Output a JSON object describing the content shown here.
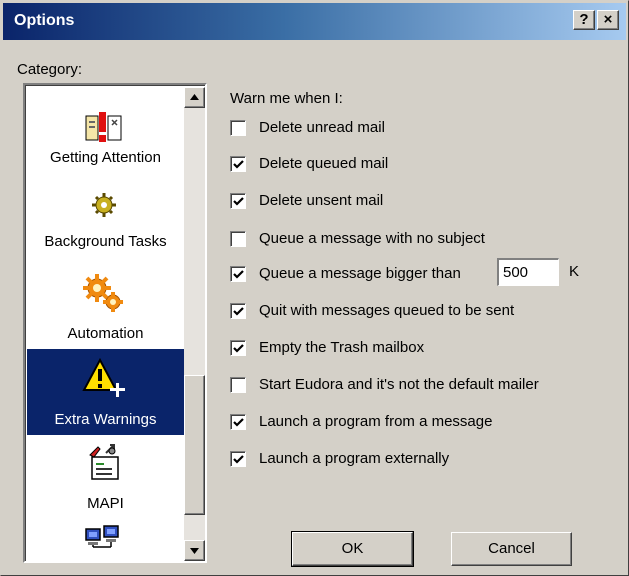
{
  "window": {
    "title": "Options",
    "help_button": "?",
    "close_button": "×"
  },
  "category": {
    "label": "Category:",
    "items": [
      {
        "label": "Getting Attention",
        "icon": "getting-attention-icon"
      },
      {
        "label": "Background Tasks",
        "icon": "background-tasks-gear-icon"
      },
      {
        "label": "Automation",
        "icon": "automation-gears-icon"
      },
      {
        "label": "Extra Warnings",
        "icon": "warning-triangle-icon",
        "selected": true
      },
      {
        "label": "MAPI",
        "icon": "mapi-icon"
      },
      {
        "label": "",
        "icon": "network-computers-icon"
      }
    ]
  },
  "warnings": {
    "title": "Warn me when I:",
    "options": [
      {
        "label": "Delete unread mail",
        "checked": false
      },
      {
        "label": "Delete queued mail",
        "checked": true
      },
      {
        "label": "Delete unsent mail",
        "checked": true
      },
      {
        "label": "Queue a message with no subject",
        "checked": false
      },
      {
        "label": "Queue a message bigger than",
        "checked": true
      },
      {
        "label": "Quit with messages queued to be sent",
        "checked": true
      },
      {
        "label": "Empty the Trash mailbox",
        "checked": true
      },
      {
        "label": "Start Eudora and it's not the default mailer",
        "checked": false
      },
      {
        "label": "Launch a program from a message",
        "checked": true
      },
      {
        "label": "Launch a program externally",
        "checked": true
      }
    ],
    "size_value": "500",
    "size_unit": "K"
  },
  "buttons": {
    "ok": "OK",
    "cancel": "Cancel"
  },
  "colors": {
    "selection": "#0a246a",
    "face": "#d4d0c8"
  }
}
